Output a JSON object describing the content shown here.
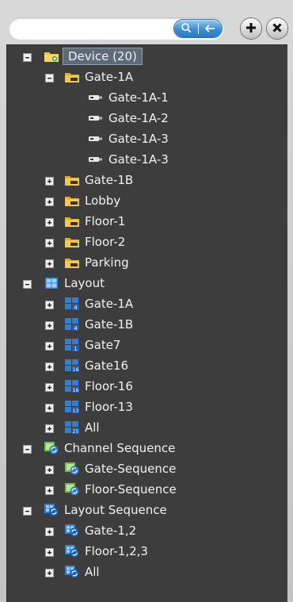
{
  "search": {
    "value": "",
    "placeholder": ""
  },
  "toolbar": {
    "search_icon": "magnifier-icon",
    "clear_icon": "arrow-left-icon",
    "add_icon": "plus-circle-icon",
    "remove_icon": "x-circle-icon"
  },
  "colors": {
    "panel_bg": "#3d3d3d",
    "selection": "#5f6a78",
    "accent": "#3a8fd6"
  },
  "tree": {
    "device": {
      "label": "Device (20)",
      "gate1a": {
        "label": "Gate-1A",
        "cams": [
          "Gate-1A-1",
          "Gate-1A-2",
          "Gate-1A-3",
          "Gate-1A-3"
        ]
      },
      "groups": [
        "Gate-1B",
        "Lobby",
        "Floor-1",
        "Floor-2",
        "Parking"
      ]
    },
    "layout": {
      "label": "Layout",
      "items": [
        {
          "label": "Gate-1A",
          "badge": "4"
        },
        {
          "label": "Gate-1B",
          "badge": "4"
        },
        {
          "label": "Gate7",
          "badge": "1"
        },
        {
          "label": "Gate16",
          "badge": "16"
        },
        {
          "label": "Floor-16",
          "badge": "16"
        },
        {
          "label": "Floor-13",
          "badge": "13"
        },
        {
          "label": "All",
          "badge": "25"
        }
      ]
    },
    "channel_sequence": {
      "label": "Channel Sequence",
      "items": [
        "Gate-Sequence",
        "Floor-Sequence"
      ]
    },
    "layout_sequence": {
      "label": "Layout Sequence",
      "items": [
        "Gate-1,2",
        "Floor-1,2,3",
        "All"
      ]
    }
  }
}
